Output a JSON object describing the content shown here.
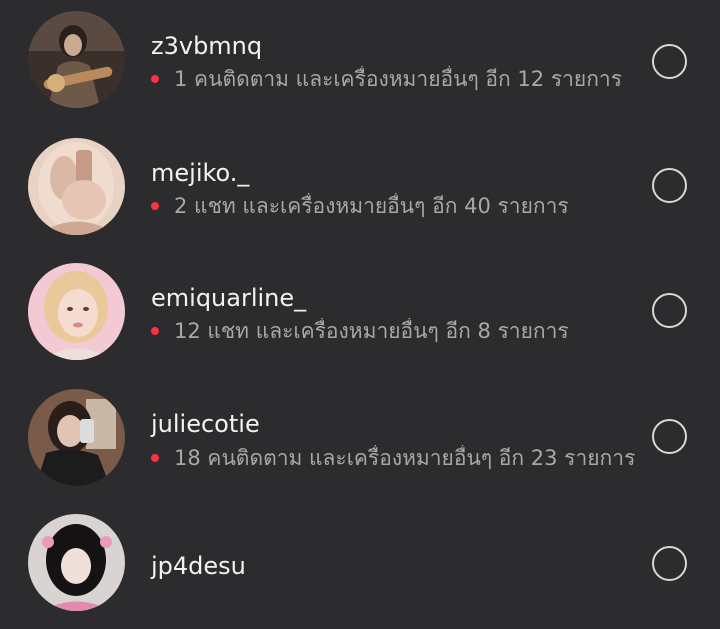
{
  "rows": [
    {
      "username": "z3vbmnq",
      "subtitle": "1 คนติดตาม และเครื่องหมายอื่นๆ อีก 12 รายการ",
      "has_dot": true
    },
    {
      "username": "mejiko._",
      "subtitle": "2 แชท และเครื่องหมายอื่นๆ อีก 40 รายการ",
      "has_dot": true
    },
    {
      "username": "emiquarline_",
      "subtitle": "12 แชท และเครื่องหมายอื่นๆ อีก 8 รายการ",
      "has_dot": true
    },
    {
      "username": "juliecotie",
      "subtitle": "18 คนติดตาม และเครื่องหมายอื่นๆ อีก 23 รายการ",
      "has_dot": true
    },
    {
      "username": "jp4desu",
      "subtitle": "",
      "has_dot": false
    }
  ],
  "colors": {
    "background": "#2c2c2e",
    "username_text": "#f2f2f2",
    "subtitle_text": "#a8a8a8",
    "notification_dot": "#ff3040",
    "radio_border": "#d8d8d8"
  },
  "icons": {
    "radio": "empty-radio-circle",
    "dot": "red-notification-dot"
  }
}
